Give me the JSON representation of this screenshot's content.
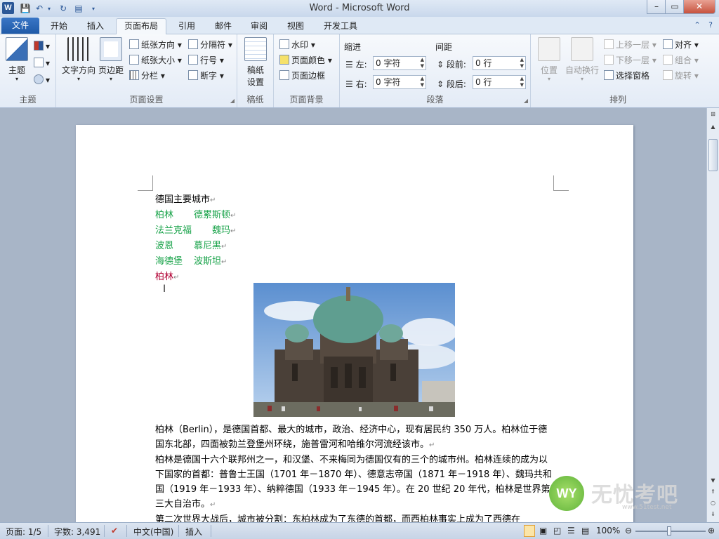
{
  "titlebar": {
    "title": "Word  -  Microsoft Word",
    "app_icon": "W",
    "minimize": "–",
    "maximize": "▭",
    "close": "✕"
  },
  "tabs": {
    "file": "文件",
    "items": [
      "开始",
      "插入",
      "页面布局",
      "引用",
      "邮件",
      "审阅",
      "视图",
      "开发工具"
    ],
    "active": "页面布局"
  },
  "ribbon": {
    "theme": {
      "label": "主题",
      "group": "主题"
    },
    "page_setup": {
      "group": "页面设置",
      "text_direction": "文字方向",
      "margins": "页边距",
      "orientation": "纸张方向",
      "size": "纸张大小",
      "columns": "分栏",
      "breaks": "分隔符",
      "line_numbers": "行号",
      "hyphenation": "断字"
    },
    "manuscript": {
      "group": "稿纸",
      "label_line1": "稿纸",
      "label_line2": "设置"
    },
    "background": {
      "group": "页面背景",
      "watermark": "水印",
      "page_color": "页面颜色",
      "page_borders": "页面边框"
    },
    "paragraph": {
      "group": "段落",
      "indent_title": "缩进",
      "spacing_title": "间距",
      "left_label": "左:",
      "right_label": "右:",
      "before_label": "段前:",
      "after_label": "段后:",
      "left_value": "0 字符",
      "right_value": "0 字符",
      "before_value": "0 行",
      "after_value": "0 行"
    },
    "arrange": {
      "group": "排列",
      "position": "位置",
      "wrap": "自动换行",
      "bring_forward": "上移一层",
      "send_backward": "下移一层",
      "selection_pane": "选择窗格",
      "align": "对齐",
      "group_btn": "组合",
      "rotate": "旋转"
    }
  },
  "document": {
    "heading": "德国主要城市",
    "city_rows": [
      {
        "a": "柏林",
        "b": "德累斯顿"
      },
      {
        "a": "法兰克福",
        "b": "魏玛"
      },
      {
        "a": "波恩",
        "b": "慕尼黑"
      },
      {
        "a": "海德堡",
        "b": "波斯坦"
      }
    ],
    "red_city": "柏林",
    "para_mark": "↵",
    "paragraphs": [
      "柏林（Berlin），是德国首都、最大的城市，政治、经济中心，现有居民约 350 万人。柏林位于德国东北部，四面被勃兰登堡州环绕，施普雷河和哈维尔河流经该市。",
      "柏林是德国十六个联邦州之一，和汉堡、不来梅同为德国仅有的三个的城市州。柏林连续的成为以下国家的首都：普鲁士王国（1701 年－1870 年）、德意志帝国（1871 年－1918 年）、魏玛共和国（1919 年－1933 年）、纳粹德国（1933 年－1945 年）。在 20 世纪 20 年代，柏林是世界第三大自治市。",
      "第二次世界大战后，城市被分割：东柏林成为了东德的首都，而西柏林事实上成为了西德在"
    ]
  },
  "status": {
    "page": "页面: 1/5",
    "words": "字数: 3,491",
    "language": "中文(中国)",
    "mode": "插入",
    "zoom": "100%"
  },
  "watermark": {
    "logo": "WY",
    "text": "无忧考吧",
    "url": "www.51test.net"
  }
}
